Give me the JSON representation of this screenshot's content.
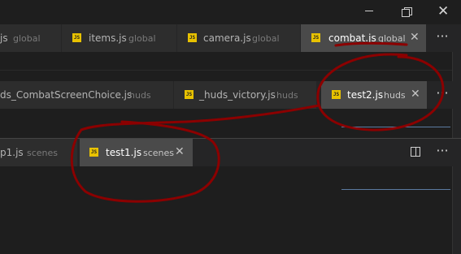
{
  "groups": [
    {
      "tabs": [
        {
          "filename": "js",
          "dir": "global",
          "active": false
        },
        {
          "filename": "items.js",
          "dir": "global",
          "active": false
        },
        {
          "filename": "camera.js",
          "dir": "global",
          "active": false
        },
        {
          "filename": "combat.js",
          "dir": "global",
          "active": true
        }
      ]
    },
    {
      "tabs": [
        {
          "filename": "ds_CombatScreenChoice.js",
          "dir": "huds",
          "active": false
        },
        {
          "filename": "_huds_victory.js",
          "dir": "huds",
          "active": false
        },
        {
          "filename": "test2.js",
          "dir": "huds",
          "active": true
        }
      ]
    },
    {
      "tabs": [
        {
          "filename": "p1.js",
          "dir": "scenes",
          "active": false
        },
        {
          "filename": "test1.js",
          "dir": "scenes",
          "active": true
        }
      ]
    }
  ],
  "icons": {
    "file": "javascript-file-icon",
    "close": "close-icon",
    "more": "more-actions-icon",
    "split": "split-editor-icon",
    "minimize": "minimize-icon",
    "restore": "restore-icon",
    "window_close": "window-close-icon"
  },
  "glyphs": {
    "js": "JS",
    "close": "✕",
    "more": "···"
  },
  "colors": {
    "tab_active": "#4a4a4a",
    "tab_inactive": "#2d2d2d",
    "editor_bg": "#1e1e1e",
    "js_icon": "#e8c200",
    "annotation": "#8b0000"
  }
}
